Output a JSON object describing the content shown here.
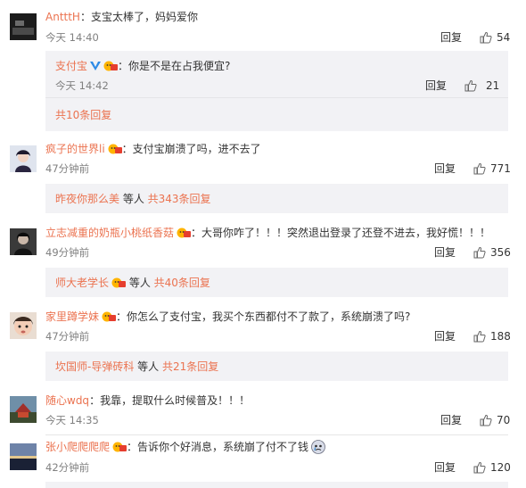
{
  "comments": [
    {
      "user": "AntttH",
      "text": "：支宝太棒了，妈妈爱你",
      "time": "今天 14:40",
      "reply_label": "回复",
      "likes": "54",
      "sub_reply": {
        "user": "支付宝",
        "text": "：你是不是在占我便宜?",
        "time": "今天 14:42",
        "reply_label": "回复",
        "likes": "21"
      },
      "more": "共10条回复"
    },
    {
      "user": "疯子的世界li",
      "text": "：支付宝崩溃了吗，进不去了",
      "time": "47分钟前",
      "reply_label": "回复",
      "likes": "771",
      "more_user": "昨夜你那么美",
      "more_mid": " 等人 ",
      "more": "共343条回复"
    },
    {
      "user": "立志减重的奶瓶小桃纸香菇",
      "text": "：大哥你咋了！！！突然退出登录了还登不进去，我好慌！！！",
      "time": "49分钟前",
      "reply_label": "回复",
      "likes": "356",
      "more_user": "师大老学长",
      "more_mid": " 等人 ",
      "more": "共40条回复"
    },
    {
      "user": "家里蹲学妹",
      "text": "：你怎么了支付宝，我买个东西都付不了款了，系统崩溃了吗?",
      "time": "47分钟前",
      "reply_label": "回复",
      "likes": "188",
      "more_user": "坎国师-导弹砖科",
      "more_mid": " 等人 ",
      "more": "共21条回复"
    },
    {
      "user": "随心wdq",
      "text": "：我靠，提取什么时候普及！！！",
      "time": "今天 14:35",
      "reply_label": "回复",
      "likes": "70"
    },
    {
      "user": "张小爬爬爬爬",
      "text": "：告诉你个好消息，系统崩了付不了钱",
      "time": "42分钟前",
      "reply_label": "回复",
      "likes": "120"
    }
  ],
  "colors": {
    "username": "#eb7350",
    "text": "#333333",
    "time": "#808080",
    "subbox_bg": "#f2f2f5"
  },
  "icons": {
    "like": "thumbs-up-icon",
    "vip_badge": "vip-badge-icon",
    "verified": "verified-v-icon"
  }
}
